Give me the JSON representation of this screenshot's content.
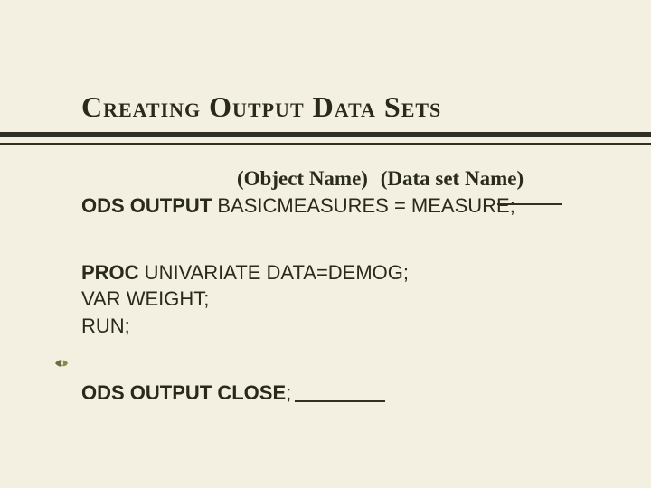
{
  "title": "Creating Output Data Sets",
  "annot": {
    "object": "(Object Name)",
    "dataset": "(Data set Name)"
  },
  "code": {
    "ods_output_kw": "ODS OUTPUT",
    "ods_output_rest": " BASICMEASURES = MEASURE;",
    "proc_kw": "PROC",
    "proc_rest": " UNIVARIATE DATA=DEMOG;",
    "var_line": " VAR WEIGHT;",
    "run_line": "RUN;",
    "close_kw": "ODS OUTPUT CLOSE",
    "close_semi": ";"
  }
}
